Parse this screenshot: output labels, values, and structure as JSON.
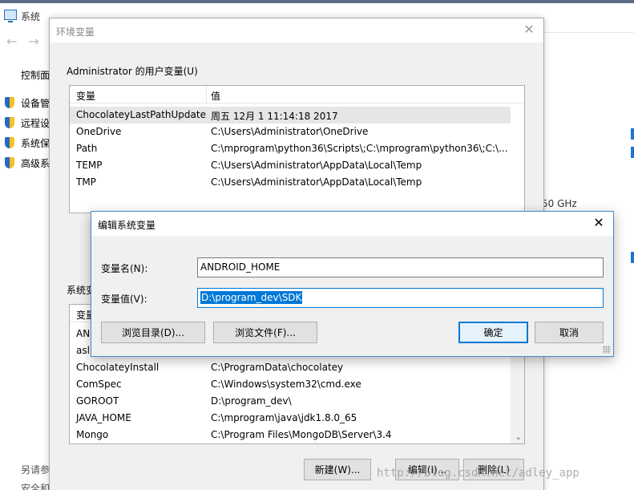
{
  "background_window": {
    "title": "系统",
    "control_panel": "控制面",
    "side_items": [
      "设备管",
      "远程设",
      "系统保",
      "高级系"
    ],
    "cpu_text": "50 GHz",
    "see_also": "另请参",
    "security": "安全和"
  },
  "env_dialog": {
    "title": "环境变量",
    "user_group": "Administrator 的用户变量(U)",
    "system_group": "系统变",
    "col_var": "变量",
    "col_val": "值",
    "user_vars": [
      {
        "name": "ChocolateyLastPathUpdate",
        "value": "周五 12月  1 11:14:18 2017"
      },
      {
        "name": "OneDrive",
        "value": "C:\\Users\\Administrator\\OneDrive"
      },
      {
        "name": "Path",
        "value": "C:\\mprogram\\python36\\Scripts\\;C:\\mprogram\\python36\\;C:\\..."
      },
      {
        "name": "TEMP",
        "value": "C:\\Users\\Administrator\\AppData\\Local\\Temp"
      },
      {
        "name": "TMP",
        "value": "C:\\Users\\Administrator\\AppData\\Local\\Temp"
      }
    ],
    "system_partial": [
      "AN",
      "asl"
    ],
    "system_vars": [
      {
        "name": "ChocolateyInstall",
        "value": "C:\\ProgramData\\chocolatey"
      },
      {
        "name": "ComSpec",
        "value": "C:\\Windows\\system32\\cmd.exe"
      },
      {
        "name": "GOROOT",
        "value": "D:\\program_dev\\"
      },
      {
        "name": "JAVA_HOME",
        "value": "C:\\mprogram\\java\\jdk1.8.0_65"
      },
      {
        "name": "Mongo",
        "value": "C:\\Program Files\\MongoDB\\Server\\3.4"
      }
    ],
    "btn_new": "新建(W)...",
    "btn_edit": "编辑(I)...",
    "btn_delete": "删除(L)"
  },
  "edit_dialog": {
    "title": "编辑系统变量",
    "name_label": "变量名(N):",
    "name_value": "ANDROID_HOME",
    "value_label": "变量值(V):",
    "value_value": "D:\\program_dev\\SDK",
    "btn_browse_dir": "浏览目录(D)...",
    "btn_browse_file": "浏览文件(F)...",
    "btn_ok": "确定",
    "btn_cancel": "取消"
  },
  "watermark": "http://blog.csdn.net/adley_app"
}
